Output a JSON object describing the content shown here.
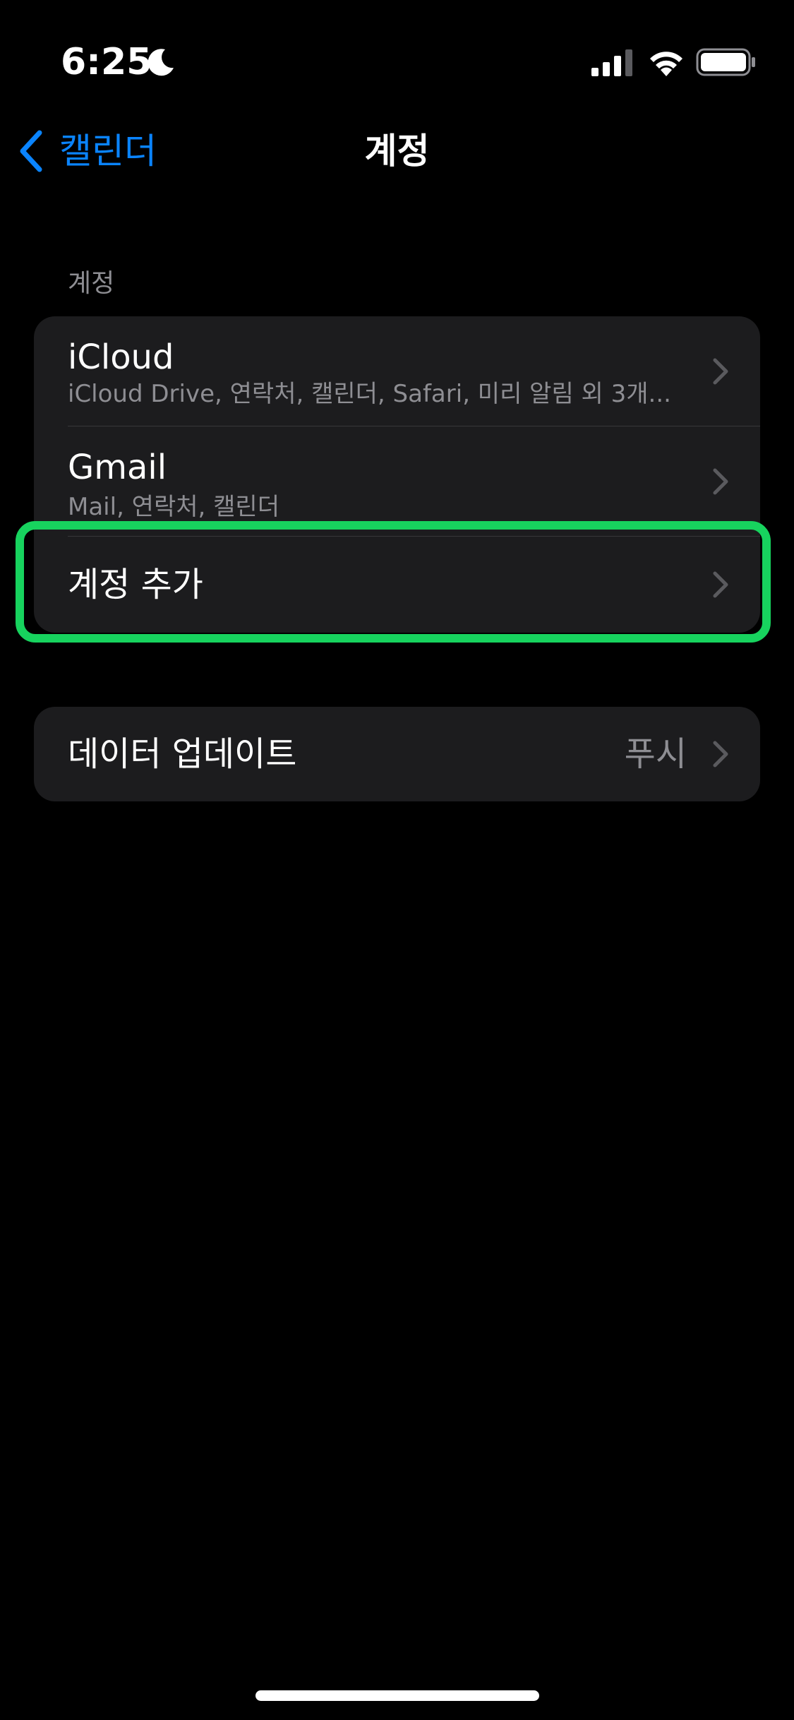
{
  "status_bar": {
    "time": "6:25",
    "icons": [
      "moon-icon",
      "cellular-signal-icon",
      "wifi-icon",
      "battery-icon"
    ]
  },
  "nav": {
    "back_label": "캘린더",
    "title": "계정"
  },
  "accounts_section": {
    "header": "계정",
    "items": [
      {
        "title": "iCloud",
        "subtitle": "iCloud Drive, 연락처, 캘린더, Safari, 미리 알림 외 3개..."
      },
      {
        "title": "Gmail",
        "subtitle": "Mail, 연락처, 캘린더"
      },
      {
        "title": "계정 추가"
      }
    ]
  },
  "data_section": {
    "items": [
      {
        "title": "데이터 업데이트",
        "value": "푸시"
      }
    ]
  },
  "colors": {
    "accent": "#0a84ff",
    "background": "#000000",
    "cell_background": "#1c1c1e",
    "secondary_text": "#8e8e93",
    "highlight": "#17d35e"
  }
}
